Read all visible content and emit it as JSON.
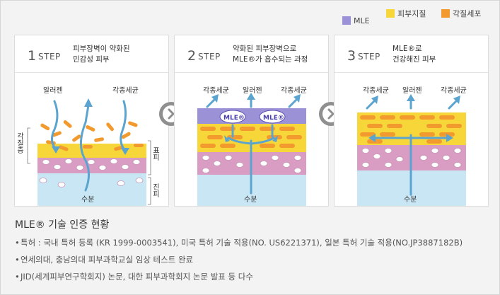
{
  "legend": [
    {
      "label": "MLE",
      "color": "#9b91d6"
    },
    {
      "label": "피부지질",
      "color": "#f7d63a"
    },
    {
      "label": "각질세포",
      "color": "#f39a2f"
    }
  ],
  "panels": [
    {
      "num": "1",
      "step": "STEP",
      "desc_line1": "피부장벽이 약화된",
      "desc_line2": "민감성 피부",
      "label_allergen": "알러젠",
      "label_bacteria": "각종세균",
      "label_water": "수분",
      "side_left": "각질층",
      "side_right_top": "표피",
      "side_right_bottom": "진피"
    },
    {
      "num": "2",
      "step": "STEP",
      "desc_line1": "약화된 피부장벽으로",
      "desc_line2": "MLE®가 흡수되는 과정",
      "label_bacteria1": "각종세균",
      "label_allergen": "알러젠",
      "label_bacteria2": "각종세균",
      "label_mle": "MLE®",
      "label_water": "수분"
    },
    {
      "num": "3",
      "step": "STEP",
      "desc_line1": "MLE®로",
      "desc_line2": "건강해진 피부",
      "label_bacteria1": "각종세균",
      "label_allergen": "알러젠",
      "label_bacteria2": "각종세균",
      "label_water": "수분"
    }
  ],
  "next_icon": "chevron-right-icon",
  "certification": {
    "title": "MLE® 기술 인증 현황",
    "items": [
      "특허 : 국내 특허 등록 (KR 1999-0003541), 미국 특허 기술 적용(NO. US6221371), 일본 특허 기술 적용(NO.JP3887182B)",
      "연세의대, 충남의대 피부과학교실 임상 테스트 완료",
      "JID(세계피부연구학회지) 논문, 대한 피부과학회지 논문 발표 등 다수"
    ]
  }
}
